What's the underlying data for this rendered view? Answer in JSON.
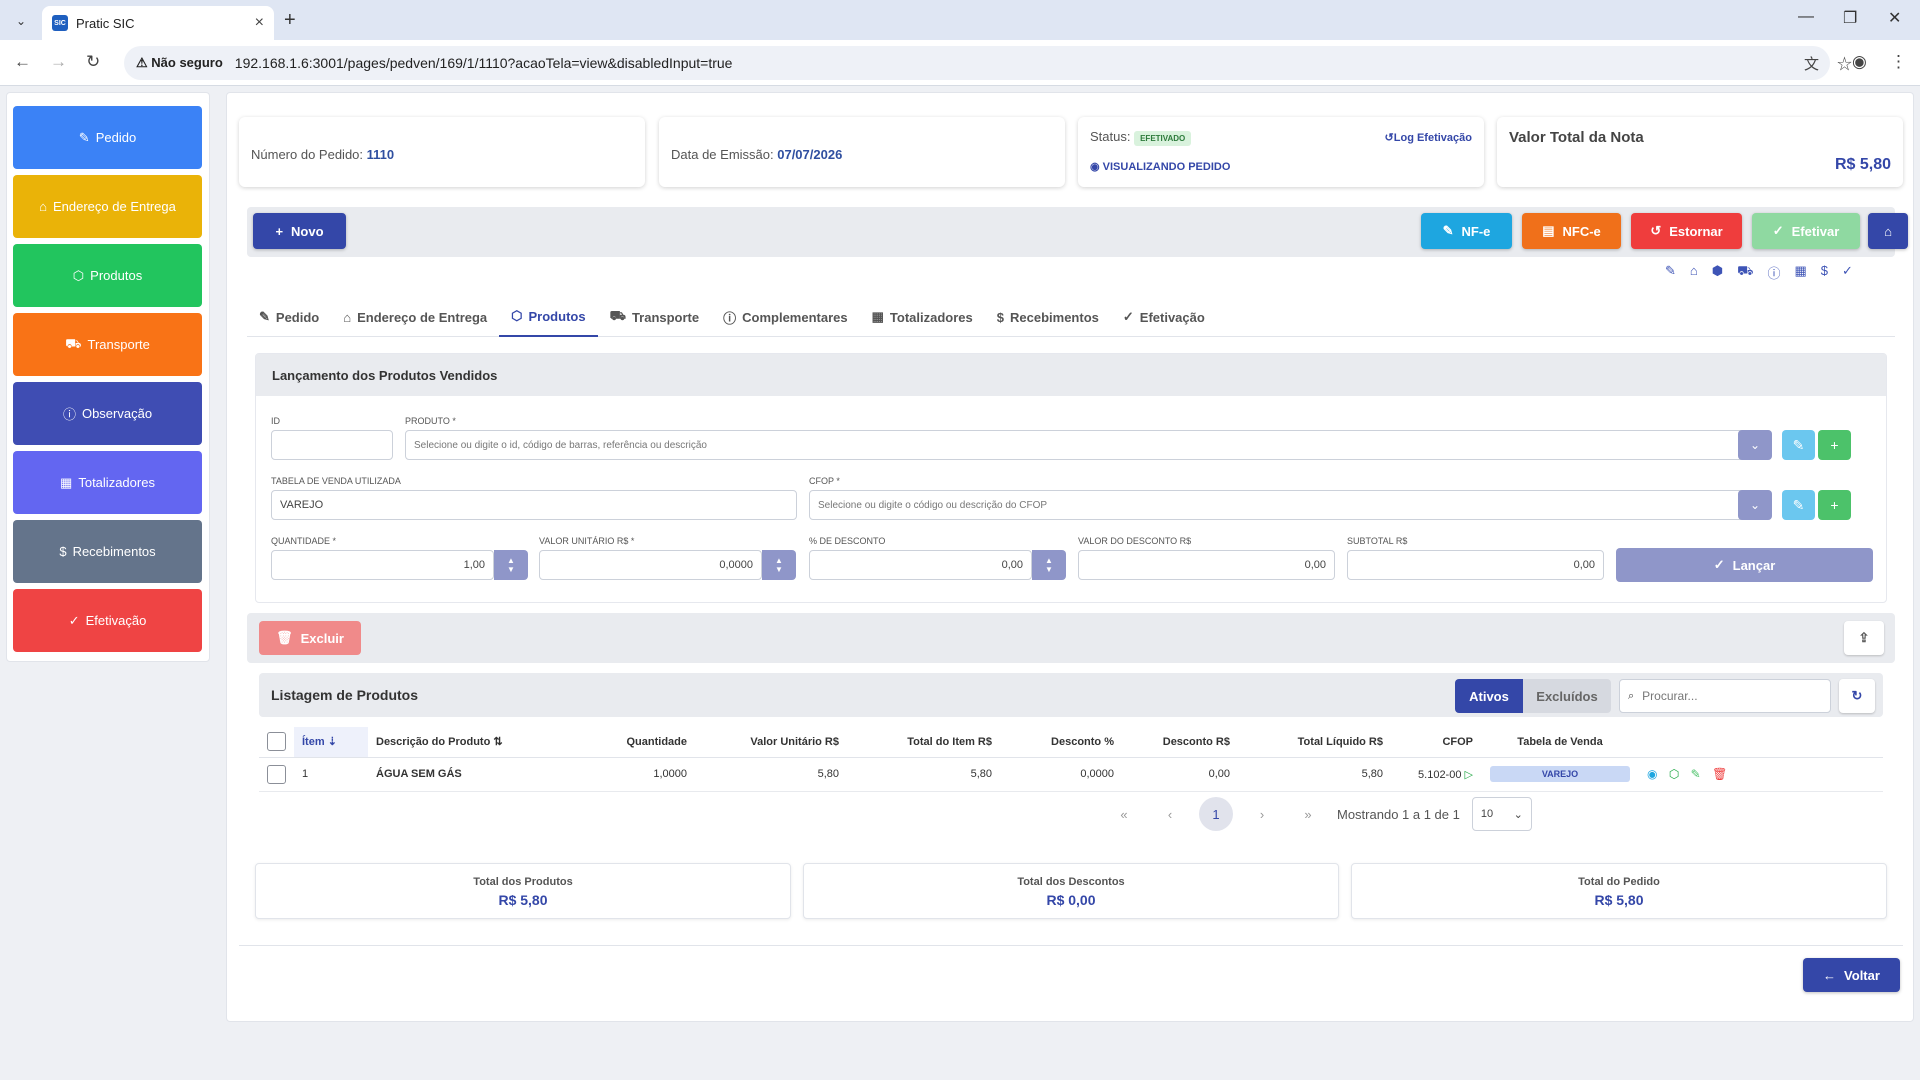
{
  "browser": {
    "tab_title": "Pratic SIC",
    "favicon_text": "SIC",
    "secure_label": "Não seguro",
    "url": "192.168.1.6:3001/pages/pedven/169/1/1110?acaoTela=view&disabledInput=true"
  },
  "sidebar": {
    "items": [
      {
        "label": "Pedido",
        "icon": "edit-icon",
        "color": "#3b82f6"
      },
      {
        "label": "Endereço de Entrega",
        "icon": "home-icon",
        "color": "#eab308"
      },
      {
        "label": "Produtos",
        "icon": "box-icon",
        "color": "#22c55e"
      },
      {
        "label": "Transporte",
        "icon": "truck-icon",
        "color": "#f97316"
      },
      {
        "label": "Observação",
        "icon": "info-icon",
        "color": "#3f4db3"
      },
      {
        "label": "Totalizadores",
        "icon": "calculator-icon",
        "color": "#6366f1"
      },
      {
        "label": "Recebimentos",
        "icon": "dollar-icon",
        "color": "#64748b"
      },
      {
        "label": "Efetivação",
        "icon": "check-icon",
        "color": "#ef4444"
      }
    ]
  },
  "header": {
    "order_number_label": "Número do Pedido:",
    "order_number": "1110",
    "issue_date_label": "Data de Emissão:",
    "issue_date": "07/07/2026",
    "status_label": "Status:",
    "status_badge": "EFETIVADO",
    "log_link": "Log Efetivação",
    "viewing_label": "VISUALIZANDO PEDIDO",
    "total_label": "Valor Total da Nota",
    "total_value": "R$ 5,80"
  },
  "toolbar": {
    "new_label": "Novo",
    "nfe_label": "NF-e",
    "nfce_label": "NFC-e",
    "reverse_label": "Estornar",
    "effect_label": "Efetivar"
  },
  "tabs": [
    {
      "label": "Pedido",
      "icon": "edit-icon"
    },
    {
      "label": "Endereço de Entrega",
      "icon": "home-icon"
    },
    {
      "label": "Produtos",
      "icon": "box-icon",
      "active": true
    },
    {
      "label": "Transporte",
      "icon": "truck-icon"
    },
    {
      "label": "Complementares",
      "icon": "info-icon"
    },
    {
      "label": "Totalizadores",
      "icon": "calculator-icon"
    },
    {
      "label": "Recebimentos",
      "icon": "dollar-icon"
    },
    {
      "label": "Efetivação",
      "icon": "check-circle-icon"
    }
  ],
  "form": {
    "title": "Lançamento dos Produtos Vendidos",
    "id_label": "ID",
    "id_value": "",
    "product_label": "PRODUTO *",
    "product_placeholder": "Selecione ou digite o id, código de barras, referência ou descrição",
    "price_table_label": "TABELA DE VENDA UTILIZADA",
    "price_table_value": "VAREJO",
    "cfop_label": "CFOP *",
    "cfop_placeholder": "Selecione ou digite o código ou descrição do CFOP",
    "qty_label": "QUANTIDADE *",
    "qty_value": "1,00",
    "unit_label": "VALOR UNITÁRIO R$ *",
    "unit_value": "0,0000",
    "disc_pct_label": "% DE DESCONTO",
    "disc_pct_value": "0,00",
    "disc_val_label": "VALOR DO DESCONTO R$",
    "disc_val_value": "0,00",
    "subtotal_label": "SUBTOTAL R$",
    "subtotal_value": "0,00",
    "launch_label": "Lançar",
    "delete_label": "Excluir"
  },
  "list": {
    "title": "Listagem de Produtos",
    "active_label": "Ativos",
    "excluded_label": "Excluídos",
    "search_placeholder": "Procurar...",
    "columns": [
      "Ítem",
      "Descrição do Produto",
      "Quantidade",
      "Valor Unitário R$",
      "Total do Item R$",
      "Desconto %",
      "Desconto R$",
      "Total Líquido R$",
      "CFOP",
      "Tabela de Venda"
    ],
    "rows": [
      {
        "item": "1",
        "desc": "ÁGUA SEM GÁS",
        "qty": "1,0000",
        "unit": "5,80",
        "total": "5,80",
        "disc_pct": "0,0000",
        "disc_val": "0,00",
        "net": "5,80",
        "cfop": "5.102-00",
        "table": "VAREJO"
      }
    ],
    "pager_current": "1",
    "showing": "Mostrando 1 a 1 de 1",
    "page_size": "10"
  },
  "totals": [
    {
      "label": "Total dos Produtos",
      "value": "R$ 5,80"
    },
    {
      "label": "Total dos Descontos",
      "value": "R$ 0,00"
    },
    {
      "label": "Total do Pedido",
      "value": "R$ 5,80"
    }
  ],
  "footer": {
    "back_label": "Voltar"
  }
}
